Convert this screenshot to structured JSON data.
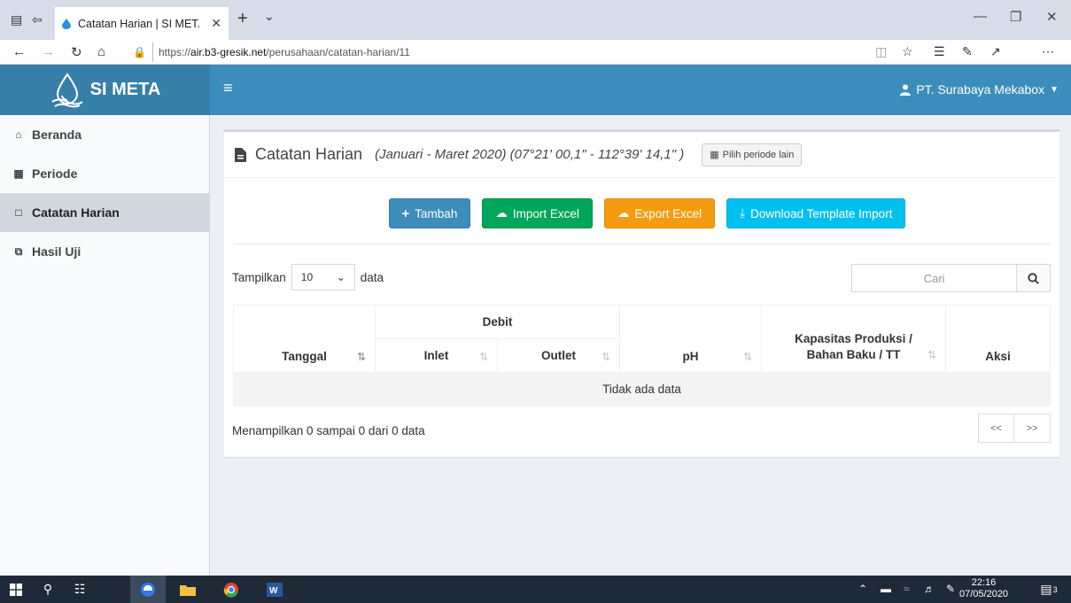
{
  "browser": {
    "tab_title": "Catatan Harian | SI MET.",
    "url_prefix": "https://",
    "url_host": "air.b3-gresik.net",
    "url_path": "/perusahaan/catatan-harian/11"
  },
  "header": {
    "brand": "SI META",
    "user_name": "PT. Surabaya Mekabox"
  },
  "sidebar": {
    "items": [
      {
        "label": "Beranda",
        "icon": "home-icon"
      },
      {
        "label": "Periode",
        "icon": "calendar-icon"
      },
      {
        "label": "Catatan Harian",
        "icon": "document-icon",
        "active": true
      },
      {
        "label": "Hasil Uji",
        "icon": "copy-icon"
      }
    ]
  },
  "main": {
    "title": "Catatan Harian",
    "subtitle": "(Januari - Maret 2020) (07°21' 00,1\" - 112°39' 14,1\" )",
    "periode_button": "Pilih periode lain",
    "actions": {
      "add": "Tambah",
      "import": "Import Excel",
      "export": "Export Excel",
      "download": "Download Template Import"
    },
    "length": {
      "prefix": "Tampilkan",
      "value": "10",
      "suffix": "data"
    },
    "search_placeholder": "Cari",
    "table": {
      "col_tanggal": "Tanggal",
      "group_debit": "Debit",
      "col_inlet": "Inlet",
      "col_outlet": "Outlet",
      "col_ph": "pH",
      "col_kapasitas": "Kapasitas Produksi / Bahan Baku / TT",
      "col_aksi": "Aksi",
      "empty": "Tidak ada data"
    },
    "info": "Menampilkan 0 sampai 0 dari 0 data",
    "pager": {
      "prev": "<<",
      "next": ">>"
    }
  },
  "taskbar": {
    "time": "22:16",
    "date": "07/05/2020",
    "notifications": "3"
  },
  "colors": {
    "primary": "#3c8dbc",
    "success": "#00a65a",
    "warning": "#f39c12",
    "info": "#00c0ef"
  }
}
